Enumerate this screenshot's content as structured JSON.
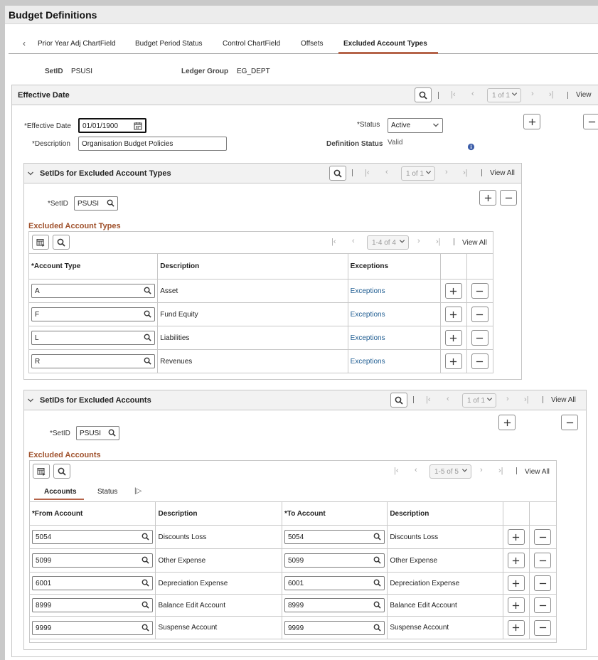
{
  "page_title": "Budget Definitions",
  "tabs": [
    {
      "label": "Prior Year Adj ChartField"
    },
    {
      "label": "Budget Period Status"
    },
    {
      "label": "Control ChartField"
    },
    {
      "label": "Offsets"
    },
    {
      "label": "Excluded Account Types"
    }
  ],
  "tab_prev_icon": "chevron-left-icon",
  "header": {
    "setid_label": "SetID",
    "setid_value": "PSUSI",
    "ledger_group_label": "Ledger Group",
    "ledger_group_value": "EG_DEPT"
  },
  "effective_date_panel": {
    "title": "Effective Date",
    "pager": "1 of 1",
    "view_all": "View",
    "eff_date_label": "*Effective Date",
    "eff_date_value": "01/01/1900",
    "status_label": "*Status",
    "status_value": "Active",
    "description_label": "*Description",
    "description_value": "Organisation Budget Policies",
    "definition_status_label": "Definition Status",
    "definition_status_value": "Valid"
  },
  "excluded_types_panel": {
    "title": "SetIDs for Excluded Account Types",
    "pager": "1 of 1",
    "view_all": "View All",
    "setid_label": "*SetID",
    "setid_value": "PSUSI",
    "grid_title": "Excluded Account Types",
    "grid_pager": "1-4 of 4",
    "grid_view_all": "View All",
    "columns": [
      "*Account Type",
      "Description",
      "Exceptions"
    ],
    "rows": [
      {
        "type": "A",
        "description": "Asset",
        "exceptions": "Exceptions"
      },
      {
        "type": "F",
        "description": "Fund Equity",
        "exceptions": "Exceptions"
      },
      {
        "type": "L",
        "description": "Liabilities",
        "exceptions": "Exceptions"
      },
      {
        "type": "R",
        "description": "Revenues",
        "exceptions": "Exceptions"
      }
    ]
  },
  "excluded_accounts_panel": {
    "title": "SetIDs for Excluded Accounts",
    "pager": "1 of 1",
    "view_all": "View All",
    "setid_label": "*SetID",
    "setid_value": "PSUSI",
    "grid_title": "Excluded Accounts",
    "grid_pager": "1-5 of 5",
    "grid_view_all": "View All",
    "subtabs": [
      "Accounts",
      "Status"
    ],
    "columns": [
      "*From Account",
      "Description",
      "*To Account",
      "Description"
    ],
    "rows": [
      {
        "from": "5054",
        "from_desc": "Discounts Loss",
        "to": "5054",
        "to_desc": "Discounts Loss"
      },
      {
        "from": "5099",
        "from_desc": "Other Expense",
        "to": "5099",
        "to_desc": "Other Expense"
      },
      {
        "from": "6001",
        "from_desc": "Depreciation Expense",
        "to": "6001",
        "to_desc": "Depreciation Expense"
      },
      {
        "from": "8999",
        "from_desc": "Balance Edit Account",
        "to": "8999",
        "to_desc": "Balance Edit Account"
      },
      {
        "from": "9999",
        "from_desc": "Suspense Account",
        "to": "9999",
        "to_desc": "Suspense Account"
      }
    ]
  },
  "colors": {
    "accent": "#b5644a",
    "link": "#1e5c91",
    "grid_title": "#a0522d"
  }
}
